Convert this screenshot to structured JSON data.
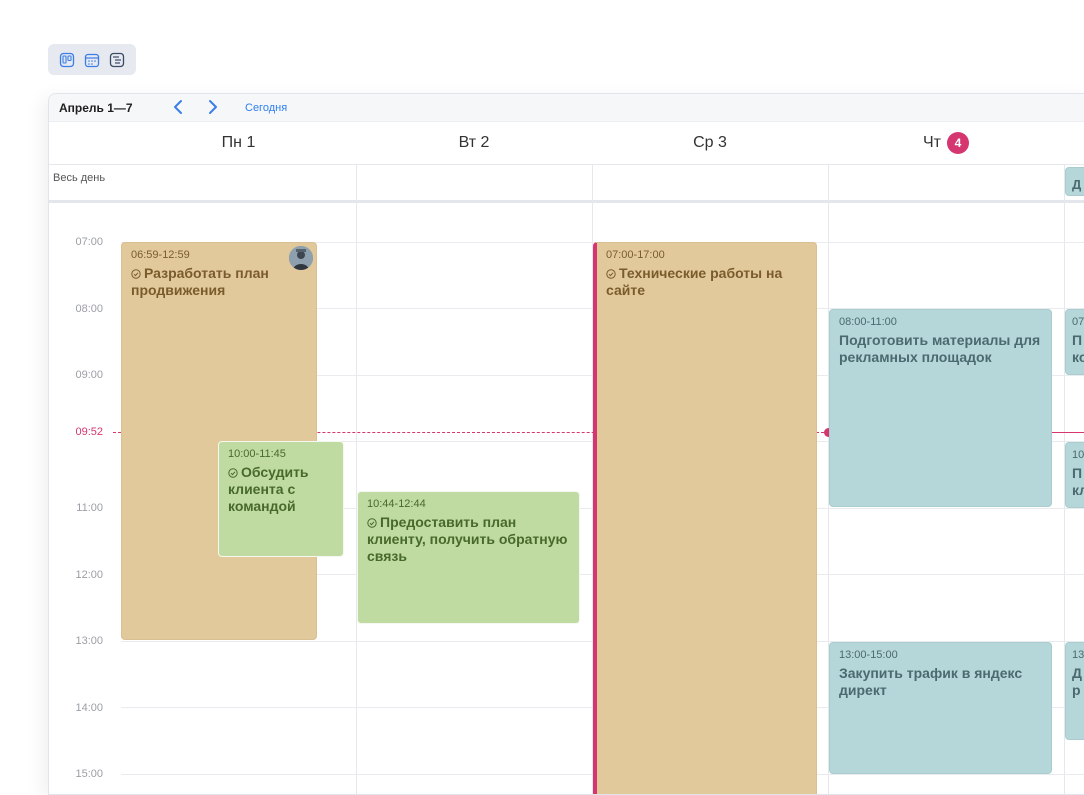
{
  "view_switch": {
    "buttons": [
      "board-view-icon",
      "calendar-view-icon",
      "list-view-icon"
    ]
  },
  "toolbar": {
    "range": "Апрель 1—7",
    "prev": "previous-week-icon",
    "next": "next-week-icon",
    "today": "Сегодня"
  },
  "days": [
    {
      "label": "Пн 1"
    },
    {
      "label": "Вт 2"
    },
    {
      "label": "Ср 3"
    },
    {
      "label": "Чт",
      "badge": "4"
    }
  ],
  "allday": {
    "label": "Весь день",
    "partial_event_text": "Д"
  },
  "hours": [
    "07:00",
    "08:00",
    "09:00",
    "10:00",
    "11:00",
    "12:00",
    "13:00",
    "14:00",
    "15:00"
  ],
  "now": {
    "label": "09:52"
  },
  "events": {
    "mon_plan": {
      "time": "06:59-12:59",
      "title": "Разработать план продвижения"
    },
    "mon_discuss": {
      "time": "10:00-11:45",
      "title": "Обсудить клиента с командой"
    },
    "tue_plan": {
      "time": "10:44-12:44",
      "title": "Предоставить план клиенту, получить обратную связь"
    },
    "wed_tech": {
      "time": "07:00-17:00",
      "title": "Технические работы на сайте"
    },
    "thu_materials": {
      "time": "08:00-11:00",
      "title": "Подготовить материалы для рекламных площадок"
    },
    "thu_traffic": {
      "time": "13:00-15:00",
      "title": "Закупить трафик в яндекс директ"
    },
    "fri_1": {
      "time": "07",
      "title_a": "П",
      "title_b": "ко"
    },
    "fri_2": {
      "time": "10",
      "title_a": "П",
      "title_b": "кл"
    },
    "fri_3": {
      "time": "13",
      "title_a": "Д",
      "title_b": "р"
    }
  },
  "colors": {
    "accent": "#d5366f",
    "link": "#2f7ff0",
    "tan": "#e2c99c",
    "green": "#c0dba2",
    "blue": "#b6d7d9"
  }
}
